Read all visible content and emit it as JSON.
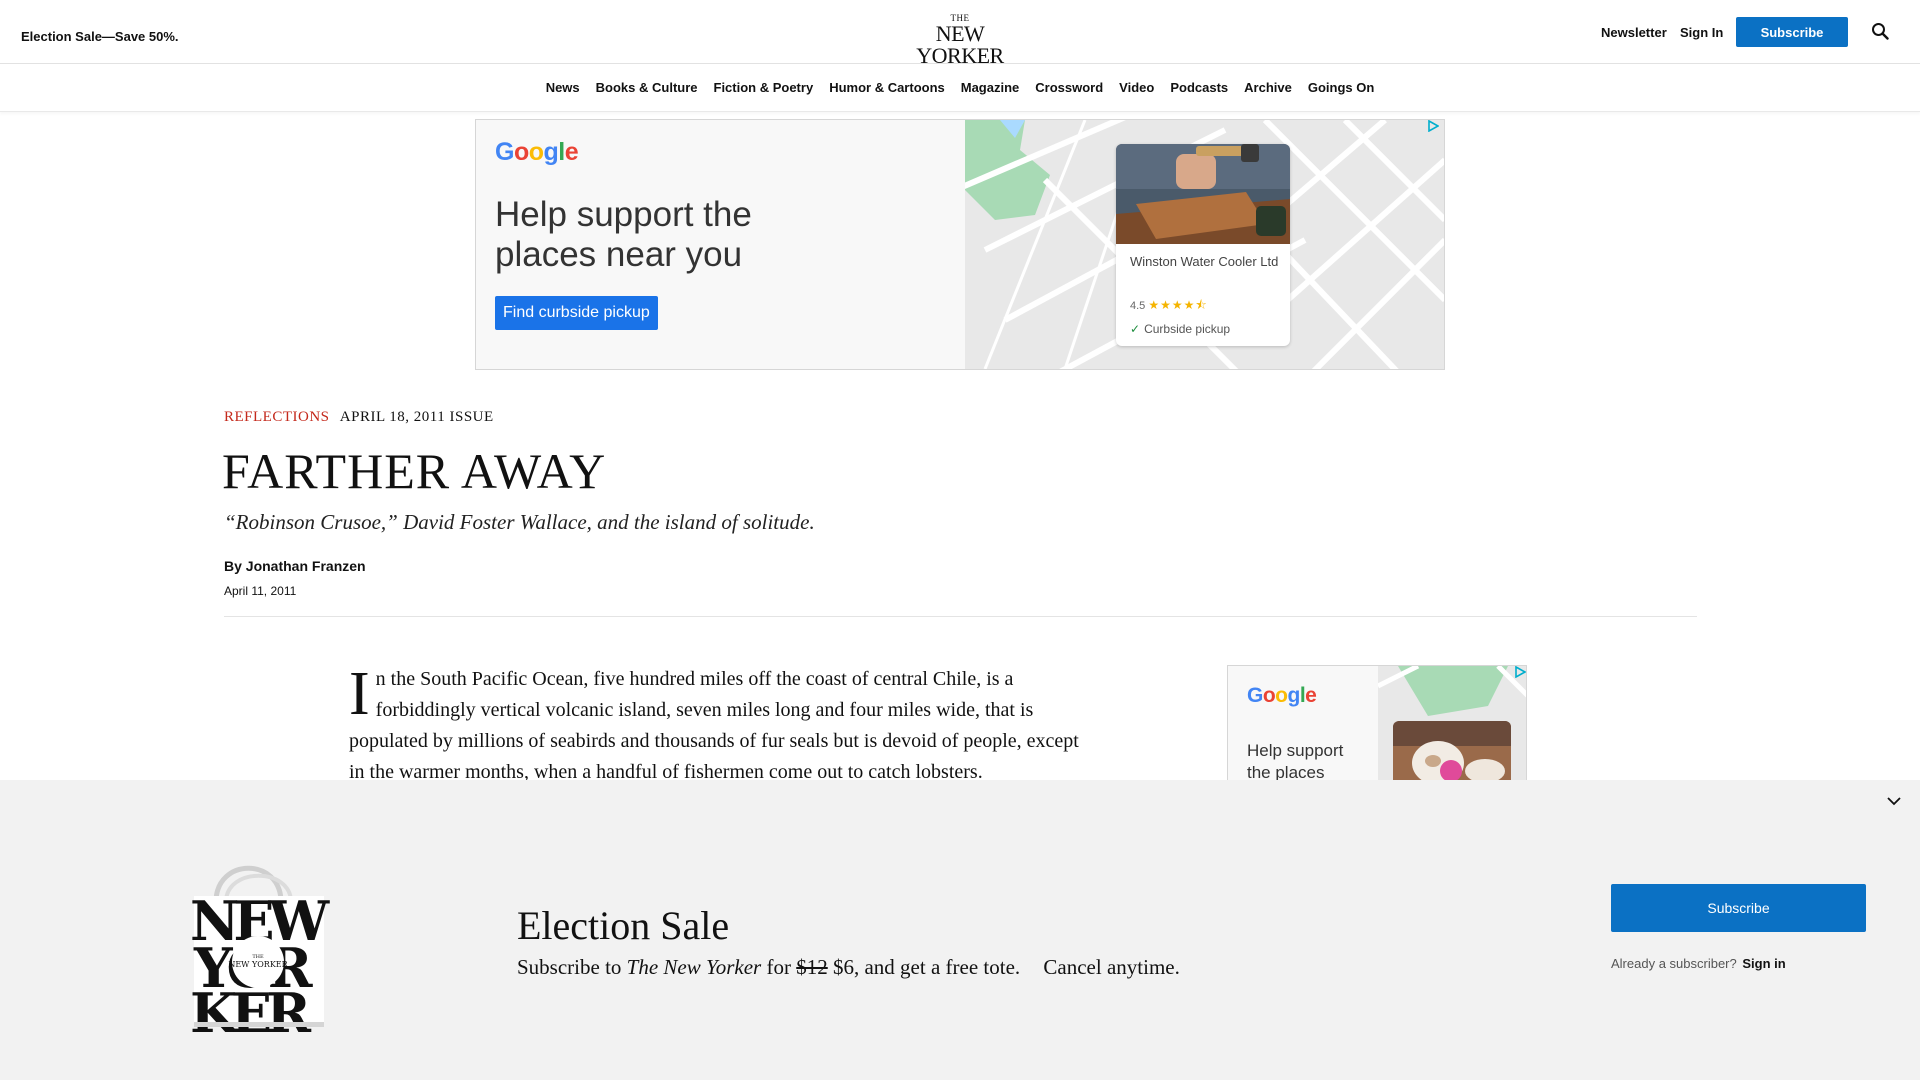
{
  "header": {
    "promo": "Election Sale—Save 50%.",
    "logo_the": "THE",
    "logo_main": "NEW YORKER",
    "newsletter": "Newsletter",
    "sign_in": "Sign In",
    "subscribe": "Subscribe",
    "search_icon": "search-icon"
  },
  "nav": {
    "items": [
      "News",
      "Books & Culture",
      "Fiction & Poetry",
      "Humor & Cartoons",
      "Magazine",
      "Crossword",
      "Video",
      "Podcasts",
      "Archive",
      "Goings On"
    ]
  },
  "ad_top": {
    "brand": "Google",
    "headline": "Help support the places near you",
    "cta": "Find curbside pickup",
    "card_name": "Winston Water Cooler Ltd",
    "rating": "4.5",
    "stars": 4.5,
    "pickup": "Curbside pickup"
  },
  "article": {
    "rubric": "REFLECTIONS",
    "issue": "APRIL 18, 2011 ISSUE",
    "headline": "FARTHER AWAY",
    "dek": "“Robinson Crusoe,” David Foster Wallace, and the island of solitude.",
    "byline_prefix": "By",
    "author": "Jonathan Franzen",
    "date": "April 11, 2011",
    "dropcap": "I",
    "body": "n the South Pacific Ocean, five hundred miles off the coast of central Chile, is a forbiddingly vertical volcanic island, seven miles long and four miles wide, that is populated by millions of seabirds and thousands of fur seals but is devoid of people, except in the warmer months, when a handful of fishermen come out to catch lobsters."
  },
  "ad_side": {
    "brand": "Google",
    "headline": "Help support the places"
  },
  "paywall": {
    "title": "Election Sale",
    "copy_prefix": "Subscribe to",
    "copy_pub": "The New Yorker",
    "copy_for": "for",
    "old_price": "$12",
    "new_price_text": "$6, and get a free tote.",
    "cancel": "Cancel anytime.",
    "subscribe": "Subscribe",
    "already": "Already a subscriber?",
    "sign_in": "Sign in",
    "tote_logo_the": "THE",
    "tote_logo_main": "NEW YORKER"
  },
  "colors": {
    "accent_blue": "#0b71c4",
    "rubric_red": "#c4291c",
    "paywall_bg": "#f2f2f2"
  }
}
